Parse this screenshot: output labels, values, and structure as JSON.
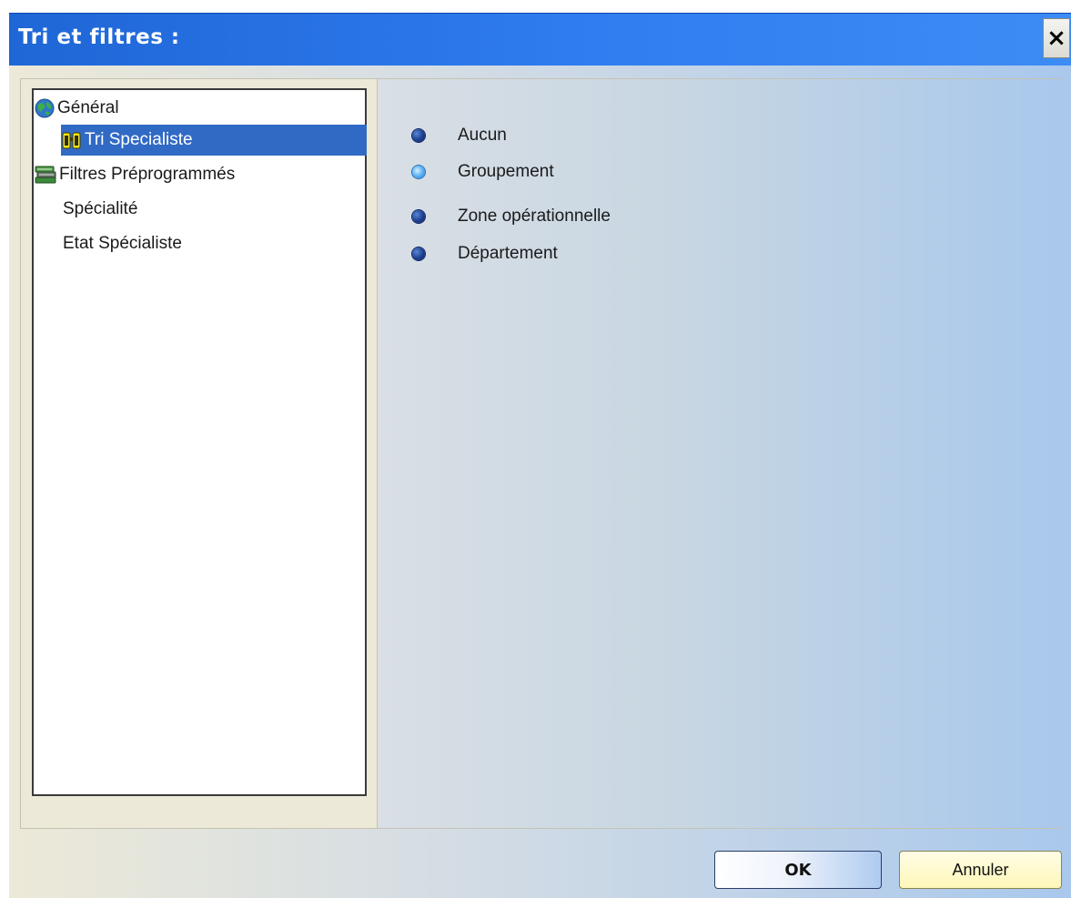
{
  "window": {
    "title": "Tri et filtres :",
    "close_label": "×"
  },
  "tree": {
    "items": [
      {
        "label": "Général",
        "icon": "globe-icon",
        "selected": false
      },
      {
        "label": "Tri Specialiste",
        "icon": "binoculars-icon",
        "selected": true
      },
      {
        "label": "Filtres Préprogrammés",
        "icon": "books-icon",
        "selected": false
      },
      {
        "label": "Spécialité",
        "icon": "",
        "selected": false
      },
      {
        "label": "Etat Spécialiste",
        "icon": "",
        "selected": false
      }
    ]
  },
  "options": {
    "items": [
      {
        "label": "Aucun",
        "checked": false
      },
      {
        "label": "Groupement",
        "checked": true
      },
      {
        "label": "Zone opérationnelle",
        "checked": false
      },
      {
        "label": "Département",
        "checked": false
      }
    ]
  },
  "buttons": {
    "ok_label": "OK",
    "cancel_label": "Annuler"
  },
  "colors": {
    "title_bar": "#2f7df0",
    "selection": "#316ac5",
    "ok_border": "#2a3c68",
    "cancel_bg": "#fff7b8"
  }
}
